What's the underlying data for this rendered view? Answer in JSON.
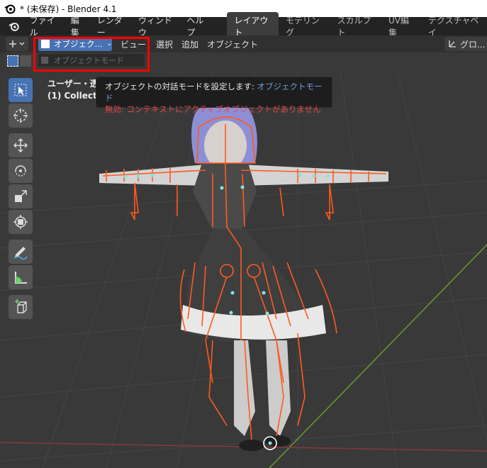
{
  "window": {
    "title": "* (未保存) - Blender 4.1"
  },
  "menu": {
    "items": [
      "ファイル",
      "編集",
      "レンダー",
      "ウィンドウ",
      "ヘルプ"
    ]
  },
  "workspaces": {
    "tabs": [
      "レイアウト",
      "モデリング",
      "スカルプト",
      "UV編集",
      "テクスチャペイ"
    ],
    "active": "レイアウト"
  },
  "header": {
    "mode_selector": "オブジェク...",
    "menus": [
      "ビュー",
      "選択",
      "追加",
      "オブジェクト"
    ],
    "transform_orientation": "グロ..."
  },
  "mode_dropdown": {
    "item": "オブジェクトモード"
  },
  "viewport": {
    "view_name": "ユーザー・透",
    "collection": "(1) Collection"
  },
  "tooltip": {
    "line1_prefix": "オブジェクトの対話モードを設定します: ",
    "line1_value": "オブジェクトモード",
    "line2": "無効: コンテキストにアクティブオブジェクトがありません"
  },
  "colors": {
    "accent": "#4772b3",
    "armature": "#ff5a1e",
    "highlight_box": "#ff0000",
    "tooltip_value": "#6f9fdc",
    "tooltip_error": "#e04848"
  }
}
